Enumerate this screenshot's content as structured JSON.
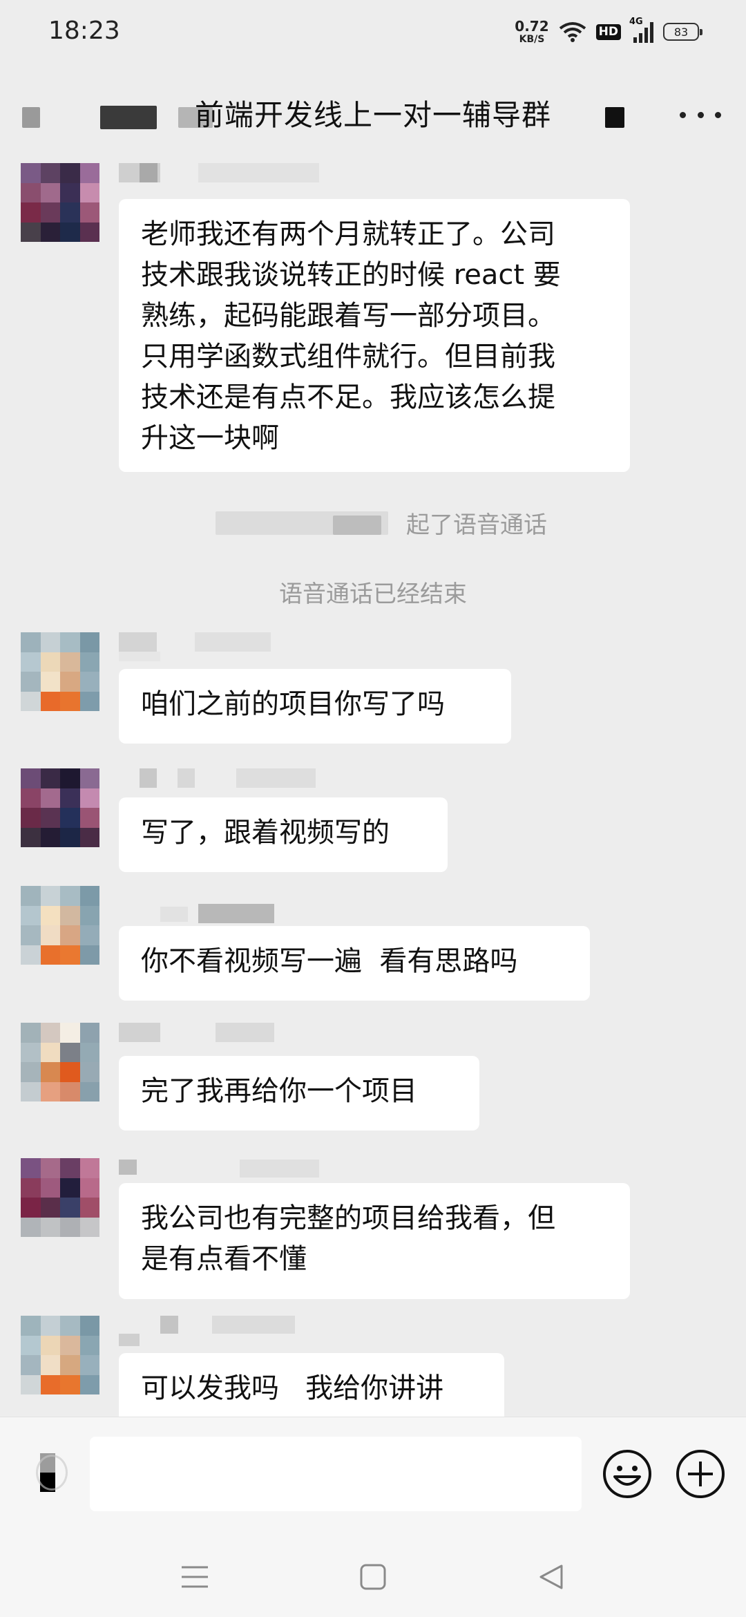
{
  "status_bar": {
    "time": "18:23",
    "net_speed_value": "0.72",
    "net_speed_unit": "KB/S",
    "hd": "HD",
    "network": "4G",
    "battery": "83"
  },
  "header": {
    "title": "前端开发线上一对一辅导群"
  },
  "messages": [
    {
      "type": "text",
      "text": "老师我还有两个月就转正了。公司\n技术跟我谈说转正的时候 react 要\n熟练，起码能跟着写一部分项目。\n只用学函数式组件就行。但目前我\n技术还是有点不足。我应该怎么提\n升这一块啊"
    },
    {
      "type": "system",
      "text": "起了语音通话"
    },
    {
      "type": "system",
      "text": "语音通话已经结束"
    },
    {
      "type": "text",
      "text": "咱们之前的项目你写了吗"
    },
    {
      "type": "text",
      "text": "写了，跟着视频写的"
    },
    {
      "type": "text",
      "text": "你不看视频写一遍  看有思路吗"
    },
    {
      "type": "text",
      "text": "完了我再给你一个项目"
    },
    {
      "type": "text",
      "text": "我公司也有完整的项目给我看，但\n是有点看不懂"
    },
    {
      "type": "text",
      "text": "可以发我吗   我给你讲讲"
    }
  ],
  "input": {
    "value": "",
    "emoji_icon": "emoji-icon",
    "add_icon": "plus-icon"
  },
  "nav": {
    "menu_icon": "menu-icon",
    "home_icon": "home-square-icon",
    "back_icon": "back-triangle-icon"
  },
  "colors": {
    "background": "#ededed",
    "bubble": "#ffffff",
    "system_text": "#9b9b9b"
  }
}
